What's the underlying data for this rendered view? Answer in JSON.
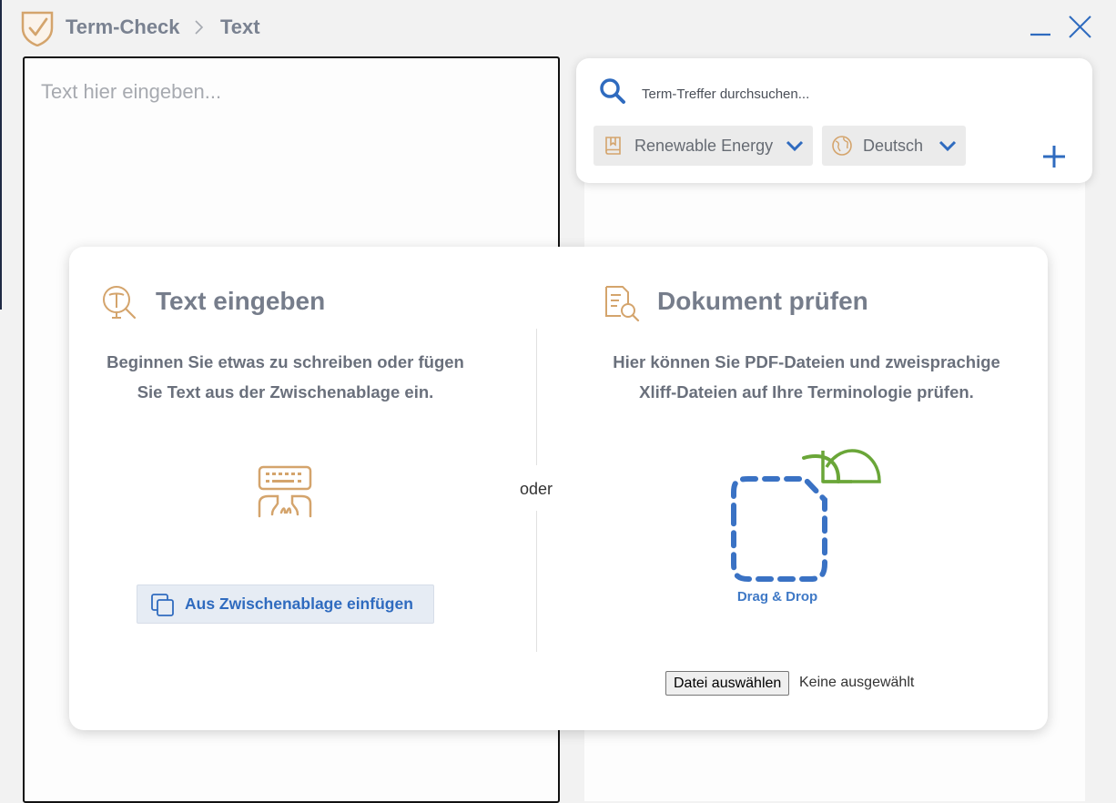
{
  "header": {
    "app_name": "Term-Check",
    "page_name": "Text",
    "logo_icon": "shield-check-icon",
    "minimize_icon": "minimize-icon",
    "close_icon": "close-icon"
  },
  "editor": {
    "placeholder": "Text hier eingeben..."
  },
  "search": {
    "icon": "search-icon",
    "placeholder": "Term-Treffer durchsuchen...",
    "domain_chip": {
      "icon": "book-icon",
      "label": "Renewable Energy"
    },
    "language_chip": {
      "icon": "globe-icon",
      "label": "Deutsch"
    },
    "add_icon": "plus-icon"
  },
  "card": {
    "left": {
      "title": "Text eingeben",
      "icon": "text-search-icon",
      "desc_line1": "Beginnen Sie etwas zu schreiben oder fügen",
      "desc_line2": "Sie Text aus der Zwischenablage ein.",
      "illustration": "typing-keyboard-icon",
      "paste_button": "Aus Zwischenablage einfügen",
      "paste_icon": "clipboard-copy-icon"
    },
    "separator": "oder",
    "right": {
      "title": "Dokument prüfen",
      "icon": "document-search-icon",
      "desc_line1": "Hier können Sie PDF-Dateien und zweisprachige",
      "desc_line2": "Xliff-Dateien auf Ihre Terminologie prüfen.",
      "drop_label": "Drag & Drop",
      "file_button": "Datei auswählen",
      "file_status": "Keine ausgewählt"
    }
  },
  "colors": {
    "accent_blue": "#2f6bbf",
    "icon_tan": "#d4a46c",
    "drop_green": "#6aa638",
    "title_gray": "#767d8b"
  }
}
